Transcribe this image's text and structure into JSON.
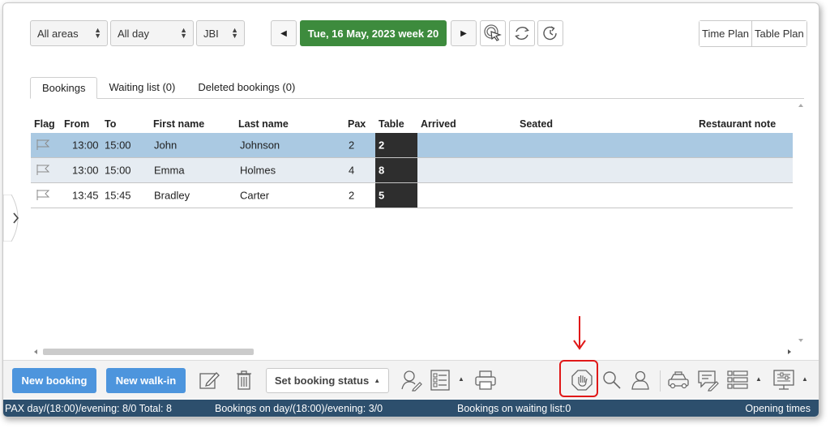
{
  "filters": {
    "area": "All areas",
    "period": "All day",
    "restaurant": "JBI"
  },
  "date_label": "Tue, 16 May, 2023 week 20",
  "plans": {
    "time_plan": "Time Plan",
    "table_plan": "Table Plan"
  },
  "tabs": [
    {
      "label": "Bookings"
    },
    {
      "label": "Waiting list (0)"
    },
    {
      "label": "Deleted bookings (0)"
    }
  ],
  "columns": {
    "flag": "Flag",
    "from": "From",
    "to": "To",
    "first_name": "First name",
    "last_name": "Last name",
    "pax": "Pax",
    "table": "Table",
    "arrived": "Arrived",
    "seated": "Seated",
    "restaurant_note": "Restaurant note"
  },
  "bookings": [
    {
      "from": "13:00",
      "to": "15:00",
      "first_name": "John",
      "last_name": "Johnson",
      "pax": "2",
      "table": "2"
    },
    {
      "from": "13:00",
      "to": "15:00",
      "first_name": "Emma",
      "last_name": "Holmes",
      "pax": "4",
      "table": "8"
    },
    {
      "from": "13:45",
      "to": "15:45",
      "first_name": "Bradley",
      "last_name": "Carter",
      "pax": "2",
      "table": "5"
    }
  ],
  "toolbar": {
    "new_booking": "New booking",
    "new_walkin": "New walk-in",
    "set_status": "Set booking status"
  },
  "status": {
    "pax": "PAX day/(18:00)/evening: 8/0 Total: 8",
    "bookings": "Bookings on day/(18:00)/evening: 3/0",
    "waiting": "Bookings on waiting list:0",
    "opening": "Opening times"
  },
  "colors": {
    "date_green": "#3d8b3d",
    "selected_row": "#aac9e2",
    "button_blue": "#4d95dd",
    "status_bar": "#2d4f6d",
    "highlight_red": "#e01818"
  }
}
